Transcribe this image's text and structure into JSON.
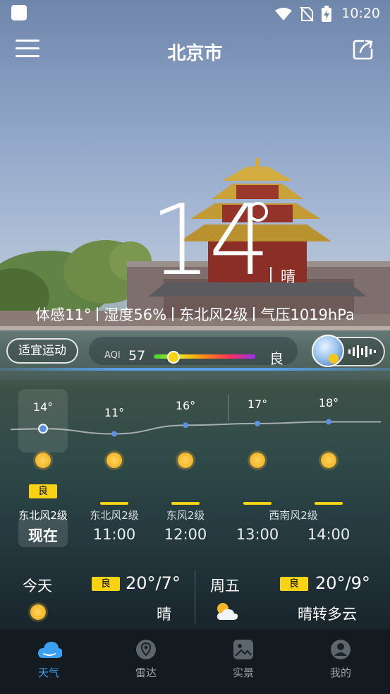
{
  "status_bar": {
    "time": "10:20",
    "icons": [
      "wifi-icon",
      "no-sim-icon",
      "battery-charging-icon"
    ]
  },
  "header": {
    "city": "北京市",
    "menu_icon": "menu-icon",
    "share_icon": "share-icon"
  },
  "current": {
    "temperature": "14",
    "condition": "晴",
    "feels_like": "体感11°",
    "humidity": "湿度56%",
    "wind": "东北风2级",
    "pressure": "气压1019hPa"
  },
  "sport_index": "适宜运动",
  "aqi": {
    "label": "AQI",
    "value": "57",
    "level": "良",
    "level_fraction": 0.19,
    "gradient": [
      "#3bd23b",
      "#e9e61a",
      "#ff8a17",
      "#ff2f5a",
      "#9b2ef7"
    ]
  },
  "hourly": [
    {
      "temp": "14°",
      "aqi_tag": "良",
      "wind": "东北风2级",
      "time": "现在",
      "temp_value": 14
    },
    {
      "temp": "11°",
      "aqi_tag": "",
      "wind": "东北风2级",
      "time": "11:00",
      "temp_value": 11
    },
    {
      "temp": "16°",
      "aqi_tag": "",
      "wind": "东风2级",
      "time": "12:00",
      "temp_value": 16
    },
    {
      "temp": "17°",
      "aqi_tag": "",
      "wind": "",
      "time": "13:00",
      "temp_value": 17
    },
    {
      "temp": "18°",
      "aqi_tag": "",
      "wind": "西南风2级",
      "time": "14:00",
      "temp_value": 18
    }
  ],
  "daily": [
    {
      "day": "今天",
      "aqi_tag": "良",
      "range": "20°/7°",
      "condition": "晴",
      "icon": "sun-icon"
    },
    {
      "day": "周五",
      "aqi_tag": "良",
      "range": "20°/9°",
      "condition": "晴转多云",
      "icon": "partly-cloudy-icon"
    }
  ],
  "tabs": [
    {
      "label": "天气",
      "icon": "weather-icon",
      "active": true
    },
    {
      "label": "雷达",
      "icon": "radar-icon",
      "active": false
    },
    {
      "label": "实景",
      "icon": "photo-icon",
      "active": false
    },
    {
      "label": "我的",
      "icon": "profile-icon",
      "active": false
    }
  ],
  "colors": {
    "accent": "#3aa0f2",
    "aqi_good": "#f7d313"
  }
}
